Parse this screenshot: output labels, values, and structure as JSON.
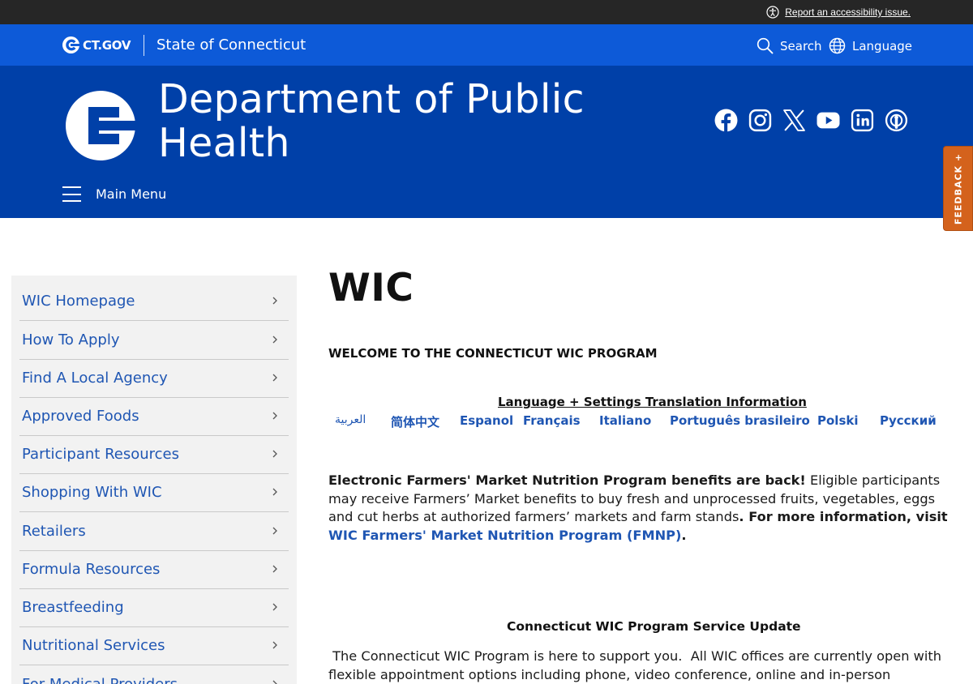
{
  "utility": {
    "accessibility_link": "Report an accessibility issue."
  },
  "ctgov": {
    "logo_text": "CT.GOV",
    "state_name": "State of Connecticut",
    "search_label": "Search",
    "language_label": "Language"
  },
  "agency": {
    "title_line1": "Department of Public",
    "title_line2": "Health",
    "main_menu_label": "Main Menu",
    "social_icons": [
      "facebook-icon",
      "instagram-icon",
      "x-icon",
      "youtube-icon",
      "linkedin-icon",
      "podcast-icon"
    ]
  },
  "feedback": {
    "label": "FEEDBACK +"
  },
  "sidebar": {
    "items": [
      {
        "label": "WIC Homepage"
      },
      {
        "label": "How To Apply"
      },
      {
        "label": "Find A Local Agency"
      },
      {
        "label": "Approved Foods"
      },
      {
        "label": "Participant Resources"
      },
      {
        "label": "Shopping With WIC"
      },
      {
        "label": "Retailers"
      },
      {
        "label": "Formula Resources"
      },
      {
        "label": "Breastfeeding"
      },
      {
        "label": "Nutritional Services"
      },
      {
        "label": "For Medical Providers"
      }
    ]
  },
  "main": {
    "title": "WIC",
    "welcome": "WELCOME TO THE CONNECTICUT WIC PROGRAM",
    "language_heading": "Language + Settings Translation Information",
    "languages": [
      "العربية",
      "简体中文",
      "Espanol",
      "Français",
      "Italiano",
      "Português brasileiro",
      "Polski",
      "Русский"
    ],
    "fmnp": {
      "bold_intro": "Electronic Farmers' Market Nutrition Program benefits are back!",
      "body": "  Eligible participants may receive Farmers’ Market benefits to buy fresh and unprocessed fruits, vegetables, eggs and cut herbs at authorized farmers’ markets and farm stands",
      "bold_more": ". For more information, visit ",
      "link": "WIC Farmers' Market Nutrition Program (FMNP)",
      "end": "."
    },
    "service_update_heading": "Connecticut WIC Program Service Update",
    "service_update_text": " The Connecticut WIC Program is here to support you.  All WIC offices are currently open with flexible appointment options including phone, video conference, online and in-person appointments.  To see"
  },
  "colors": {
    "utility_bar": "#262626",
    "ctgov_blue": "#0d5ad8",
    "agency_blue": "#0040a8",
    "link_blue": "#1f56b3",
    "feedback_orange": "#d4621c"
  }
}
